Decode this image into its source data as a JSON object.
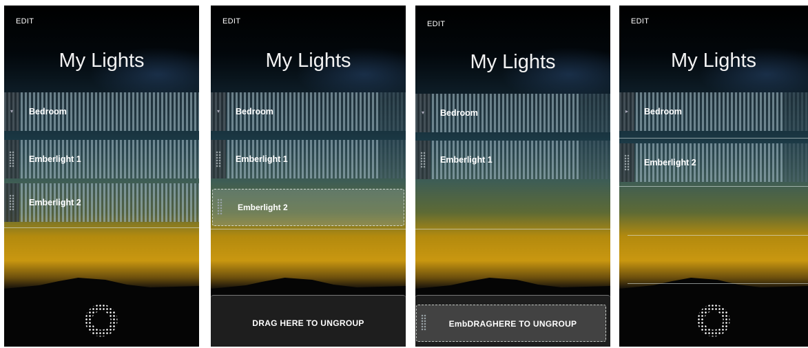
{
  "edit_label": "EDIT",
  "title": "My Lights",
  "rows": [
    "Bedroom",
    "Emberlight 1",
    "Emberlight 2"
  ],
  "dropzone_label": "DRAG HERE TO UNGROUP",
  "overlap_text": "EmbDRAGHERE TO UNGROUP",
  "colors": {
    "background": "#000000",
    "dropzone": "#1e1e1e",
    "text": "#ffffff"
  },
  "icons": [
    "chevron-icon",
    "drag-handle-icon",
    "emberlight-logo-icon"
  ]
}
